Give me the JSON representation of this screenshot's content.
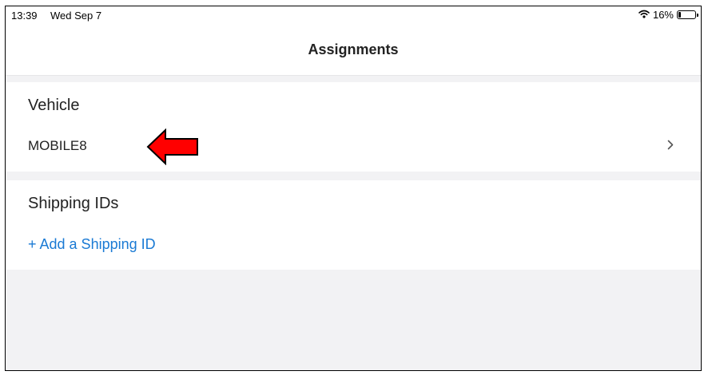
{
  "status_bar": {
    "time": "13:39",
    "date": "Wed Sep 7",
    "battery_percent": "16%",
    "battery_level": 0.16
  },
  "nav": {
    "title": "Assignments"
  },
  "vehicle_section": {
    "header": "Vehicle",
    "value": "MOBILE8",
    "chevron_icon": "chevron-right-icon"
  },
  "shipping_section": {
    "header": "Shipping IDs",
    "add_link": "+ Add a Shipping ID"
  },
  "annotation": {
    "icon": "red-arrow-left-icon",
    "color": "#ff0000"
  },
  "colors": {
    "link": "#1a7ad4",
    "background": "#f2f2f4"
  }
}
